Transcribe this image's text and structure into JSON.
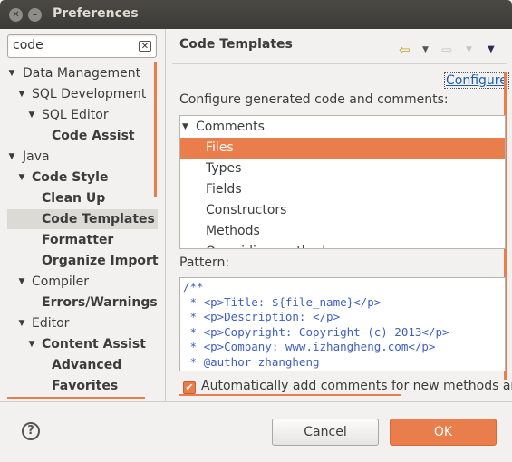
{
  "window": {
    "title": "Preferences"
  },
  "search": {
    "value": "code"
  },
  "tree": [
    {
      "label": "Data Management",
      "arrow": "▼",
      "level": 0,
      "bold": false,
      "selected": false
    },
    {
      "label": "SQL Development",
      "arrow": "▼",
      "level": 1,
      "bold": false,
      "selected": false
    },
    {
      "label": "SQL Editor",
      "arrow": "▼",
      "level": 2,
      "bold": false,
      "selected": false
    },
    {
      "label": "Code Assist",
      "arrow": "",
      "level": 3,
      "bold": true,
      "selected": false
    },
    {
      "label": "Java",
      "arrow": "▼",
      "level": 0,
      "bold": false,
      "selected": false
    },
    {
      "label": "Code Style",
      "arrow": "▼",
      "level": 1,
      "bold": true,
      "selected": false
    },
    {
      "label": "Clean Up",
      "arrow": "",
      "level": 2,
      "bold": true,
      "selected": false
    },
    {
      "label": "Code Templates",
      "arrow": "",
      "level": 2,
      "bold": true,
      "selected": true
    },
    {
      "label": "Formatter",
      "arrow": "",
      "level": 2,
      "bold": true,
      "selected": false
    },
    {
      "label": "Organize Imports",
      "arrow": "",
      "level": 2,
      "bold": true,
      "selected": false
    },
    {
      "label": "Compiler",
      "arrow": "▼",
      "level": 1,
      "bold": false,
      "selected": false
    },
    {
      "label": "Errors/Warnings",
      "arrow": "",
      "level": 2,
      "bold": true,
      "selected": false
    },
    {
      "label": "Editor",
      "arrow": "▼",
      "level": 1,
      "bold": false,
      "selected": false
    },
    {
      "label": "Content Assist",
      "arrow": "▼",
      "level": 2,
      "bold": true,
      "selected": false
    },
    {
      "label": "Advanced",
      "arrow": "",
      "level": 3,
      "bold": true,
      "selected": false
    },
    {
      "label": "Favorites",
      "arrow": "",
      "level": 3,
      "bold": true,
      "selected": false
    }
  ],
  "page": {
    "title": "Code Templates",
    "configure_link": "Configure",
    "configure_label": "Configure generated code and comments:",
    "pattern_label": "Pattern:",
    "checkbox_label": "Automatically add comments for new methods and",
    "checkbox_checked": true
  },
  "templates": [
    {
      "label": "Comments",
      "arrow": "▼",
      "level": 0,
      "selected": false
    },
    {
      "label": "Files",
      "arrow": "",
      "level": 1,
      "selected": true
    },
    {
      "label": "Types",
      "arrow": "",
      "level": 1,
      "selected": false
    },
    {
      "label": "Fields",
      "arrow": "",
      "level": 1,
      "selected": false
    },
    {
      "label": "Constructors",
      "arrow": "",
      "level": 1,
      "selected": false
    },
    {
      "label": "Methods",
      "arrow": "",
      "level": 1,
      "selected": false
    },
    {
      "label": "Overriding methods",
      "arrow": "",
      "level": 1,
      "selected": false
    }
  ],
  "pattern_lines": [
    "/**",
    " * <p>Title: ${file_name}</p>",
    " * <p>Description: </p>",
    " * <p>Copyright: Copyright (c) 2013</p>",
    " * <p>Company: www.izhangheng.com</p>",
    " * @author zhangheng"
  ],
  "buttons": {
    "cancel": "Cancel",
    "ok": "OK",
    "help": "?"
  },
  "colors": {
    "accent": "#e97d4b",
    "link": "#1a5ea8",
    "javadoc": "#3f5fbf"
  }
}
